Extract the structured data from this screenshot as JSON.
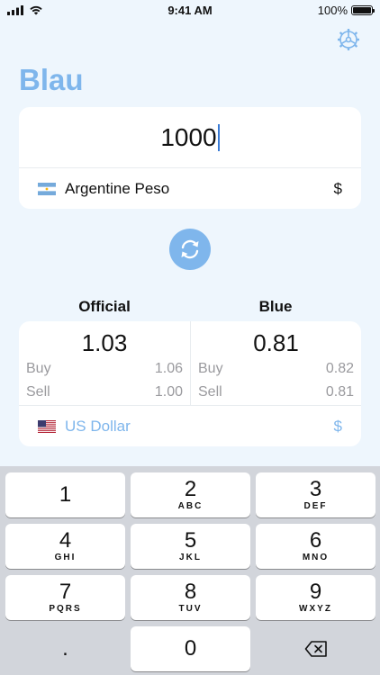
{
  "status_bar": {
    "time": "9:41 AM",
    "battery": "100%"
  },
  "app": {
    "title": "Blau"
  },
  "input": {
    "amount": "1000",
    "currency_name": "Argentine Peso",
    "currency_symbol": "$",
    "flag_icon": "argentina-flag-icon"
  },
  "rates": {
    "official": {
      "header": "Official",
      "value": "1.03",
      "buy_label": "Buy",
      "buy_value": "1.06",
      "sell_label": "Sell",
      "sell_value": "1.00"
    },
    "blue": {
      "header": "Blue",
      "value": "0.81",
      "buy_label": "Buy",
      "buy_value": "0.82",
      "sell_label": "Sell",
      "sell_value": "0.81"
    },
    "target_currency_name": "US Dollar",
    "target_currency_symbol": "$",
    "target_flag_icon": "us-flag-icon"
  },
  "keyboard": {
    "keys": [
      {
        "digit": "1",
        "letters": ""
      },
      {
        "digit": "2",
        "letters": "ABC"
      },
      {
        "digit": "3",
        "letters": "DEF"
      },
      {
        "digit": "4",
        "letters": "GHI"
      },
      {
        "digit": "5",
        "letters": "JKL"
      },
      {
        "digit": "6",
        "letters": "MNO"
      },
      {
        "digit": "7",
        "letters": "PQRS"
      },
      {
        "digit": "8",
        "letters": "TUV"
      },
      {
        "digit": "9",
        "letters": "WXYZ"
      },
      {
        "digit": ".",
        "letters": ""
      },
      {
        "digit": "0",
        "letters": ""
      }
    ],
    "delete_icon": "backspace-icon"
  },
  "colors": {
    "accent": "#7fb6ec",
    "background": "#eef6fd",
    "keyboard_bg": "#d2d5db"
  }
}
